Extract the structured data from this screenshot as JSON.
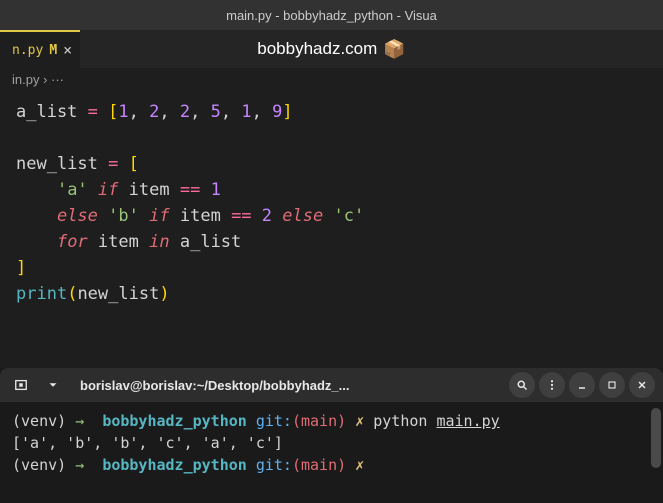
{
  "titlebar": "main.py - bobbyhadz_python - Visua",
  "tab": {
    "name": "n.py",
    "modified": "M",
    "close": "×"
  },
  "watermark": "bobbyhadz.com",
  "breadcrumb": "in.py › ···",
  "code": {
    "l1_var": "a_list",
    "l1_eq": " = ",
    "l1_open": "[",
    "l1_n1": "1",
    "l1_n2": "2",
    "l1_n3": "2",
    "l1_n4": "5",
    "l1_n5": "1",
    "l1_n6": "9",
    "l1_close": "]",
    "l3_var": "new_list",
    "l3_eq": " = ",
    "l3_open": "[",
    "l4_s1": "'a'",
    "l4_if": "if",
    "l4_item": "item",
    "l4_eq": "==",
    "l4_n": "1",
    "l5_else1": "else",
    "l5_s": "'b'",
    "l5_if": "if",
    "l5_item": "item",
    "l5_eq": "==",
    "l5_n": "2",
    "l5_else2": "else",
    "l5_s2": "'c'",
    "l6_for": "for",
    "l6_item": "item",
    "l6_in": "in",
    "l6_list": "a_list",
    "l7_close": "]",
    "l8_fn": "print",
    "l8_open": "(",
    "l8_arg": "new_list",
    "l8_close": ")"
  },
  "terminal": {
    "title": "borislav@borislav:~/Desktop/bobbyhadz_...",
    "venv": "(venv)",
    "arrow": "→",
    "path": "bobbyhadz_python",
    "git": "git:",
    "branch": "main",
    "x": "✗",
    "cmd_python": "python",
    "cmd_file": "main.py",
    "output": "['a', 'b', 'b', 'c', 'a', 'c']"
  }
}
